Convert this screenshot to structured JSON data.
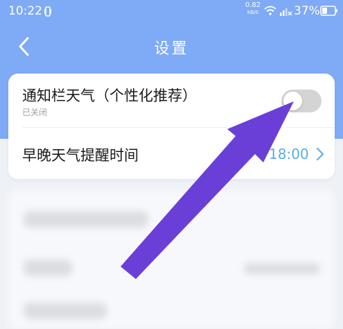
{
  "status_bar": {
    "time": "10:22",
    "net_speed_value": "0.82",
    "net_speed_unit": "KB/S",
    "battery": "37%"
  },
  "nav": {
    "title": "设置",
    "back_icon": "chevron-left-icon"
  },
  "settings": {
    "notification_weather": {
      "title": "通知栏天气（个性化推荐）",
      "subtitle": "已关闭",
      "enabled": false
    },
    "reminder_time": {
      "title": "早晚天气提醒时间",
      "value": "18:00"
    }
  },
  "colors": {
    "header": "#7faaf5",
    "accent_value": "#5aaee8",
    "annotation_arrow": "#6a3fd8",
    "toggle_off": "#d4d4d4"
  },
  "annotation": {
    "type": "arrow",
    "points_to": "notification-weather-toggle"
  }
}
